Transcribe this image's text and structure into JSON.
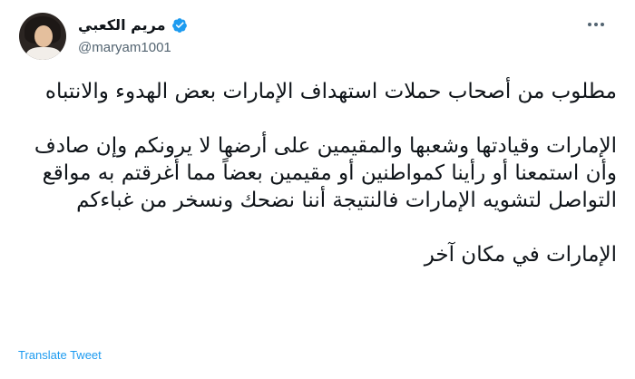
{
  "author": {
    "display_name": "مريم الكعبي",
    "handle": "@maryam1001",
    "verified": true
  },
  "tweet": {
    "paragraphs": [
      "مطلوب من أصحاب حملات استهداف الإمارات بعض الهدوء والانتباه",
      "الإمارات وقيادتها وشعبها والمقيمين على أرضها لا يرونكم وإن صادف وأن استمعنا أو رأينا كمواطنين أو مقيمين بعضاً مما أغرقتم به مواقع التواصل لتشويه الإمارات فالنتيجة أننا نضحك ونسخر من غباءكم",
      "الإمارات في مكان آخر"
    ]
  },
  "actions": {
    "translate_label": "Translate Tweet"
  },
  "icons": {
    "verified": "verified-badge-icon",
    "more": "more-options-icon"
  },
  "colors": {
    "accent": "#1d9bf0",
    "text": "#0f1419",
    "secondary": "#536471"
  }
}
